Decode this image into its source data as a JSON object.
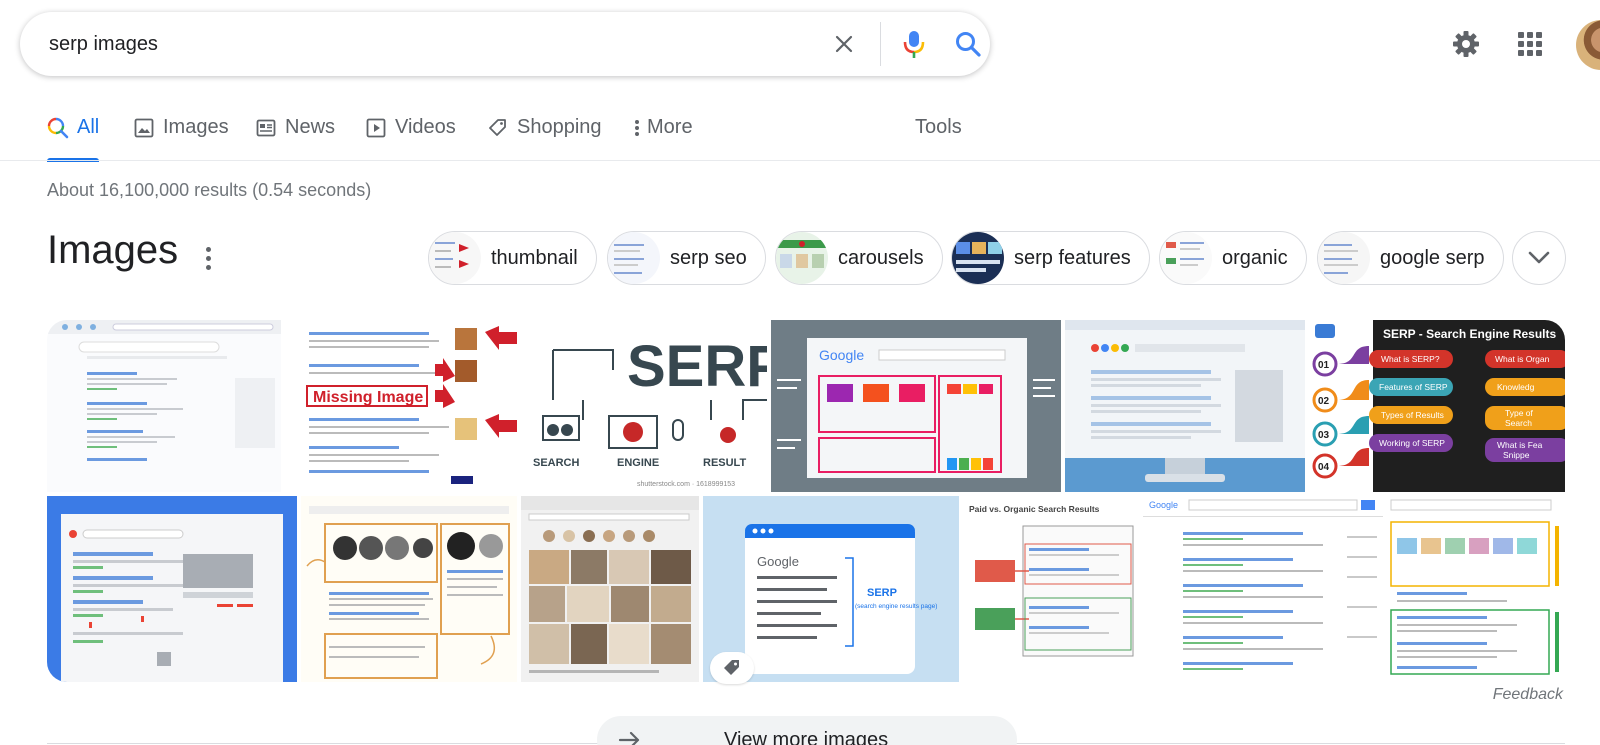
{
  "search": {
    "query": "serp images"
  },
  "tabs": [
    {
      "label": "All",
      "icon": "search-multicolor-icon",
      "active": true
    },
    {
      "label": "Images",
      "icon": "image-icon"
    },
    {
      "label": "News",
      "icon": "newspaper-icon"
    },
    {
      "label": "Videos",
      "icon": "play-icon"
    },
    {
      "label": "Shopping",
      "icon": "tag-icon"
    },
    {
      "label": "More",
      "icon": "more-vert-icon"
    }
  ],
  "tools_label": "Tools",
  "result_stats": "About 16,100,000 results (0.54 seconds)",
  "images_section": {
    "heading": "Images",
    "chips": [
      {
        "label": "thumbnail"
      },
      {
        "label": "serp seo"
      },
      {
        "label": "carousels"
      },
      {
        "label": "serp features"
      },
      {
        "label": "organic"
      },
      {
        "label": "google serp"
      }
    ],
    "feedback": "Feedback",
    "view_more": "View more images"
  },
  "image_text": {
    "missing": "Missing Image",
    "serp_word": "SERP",
    "search": "SEARCH",
    "engine": "ENGINE",
    "result": "RESULT",
    "shutter": "shutterstock.com · 1618999153",
    "infographic_title": "SERP - Search Engine Results",
    "pill_1": "What is SERP?",
    "pill_2": "Features of SERP",
    "pill_3": "Types of Results",
    "pill_4": "Working of SERP",
    "pill_r1": "What is Organ",
    "pill_r2": "Knowledg",
    "pill_r3": "Type of",
    "pill_r3b": "Search",
    "pill_r4": "What is Fea",
    "pill_r4b": "Snippe",
    "num_1": "01",
    "num_2": "02",
    "num_3": "03",
    "num_4": "04",
    "google_word": "Google",
    "serp_label": "SERP",
    "serp_sub": "(search engine results page)",
    "paid_organic": "Paid vs. Organic Search Results"
  },
  "colors": {
    "accent": "#1a73e8",
    "muted": "#5f6368",
    "stats": "#70757a",
    "divider": "#dadce0"
  }
}
